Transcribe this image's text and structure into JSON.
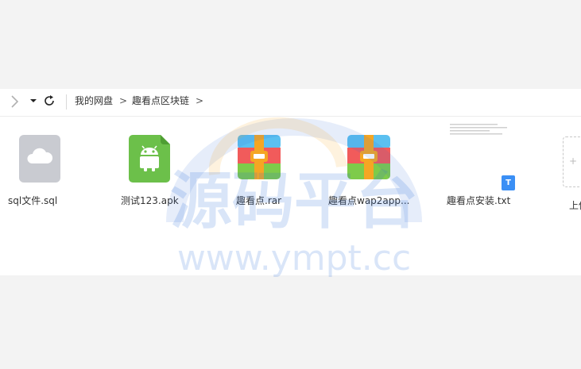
{
  "breadcrumb": {
    "root": "我的网盘",
    "separator": ">",
    "current": "趣看点区块链"
  },
  "files": [
    {
      "name": "sql文件.sql",
      "icon": "cloud-file-icon"
    },
    {
      "name": "测试123.apk",
      "icon": "android-apk-icon"
    },
    {
      "name": "趣看点.rar",
      "icon": "archive-rar-icon"
    },
    {
      "name": "趣看点wap2app...",
      "icon": "archive-rar-icon"
    },
    {
      "name": "趣看点安装.txt",
      "icon": "text-file-icon"
    }
  ],
  "txt_badge": "T",
  "upload": {
    "label": "上传"
  },
  "watermark": {
    "title": "源码平台",
    "url": "www.ympt.cc"
  },
  "colors": {
    "accent": "#3a8ff5",
    "apk_green": "#6cc04a",
    "rar_blue": "#5bc0f0",
    "rar_red": "#f15b5b",
    "rar_green": "#7ecb4a",
    "rar_orange": "#f5a623"
  }
}
